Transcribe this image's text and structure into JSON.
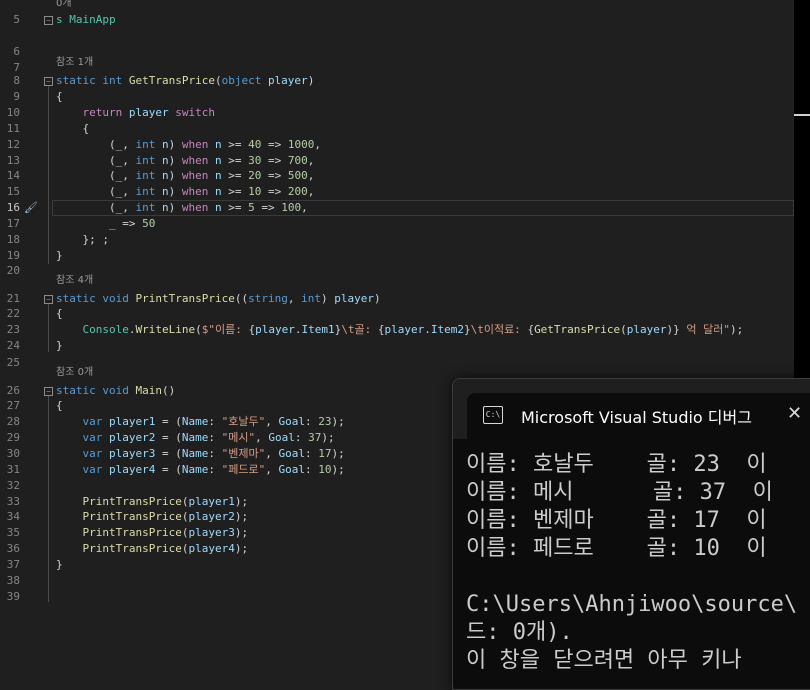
{
  "editor": {
    "lines": [
      {
        "num": "5",
        "code": [
          {
            "t": "s MainApp",
            "c": "ty"
          }
        ],
        "ref": "0개"
      },
      {
        "num": "6",
        "code": []
      },
      {
        "num": "7",
        "code": []
      },
      {
        "num": "8",
        "code": [
          {
            "t": "static ",
            "c": "kw"
          },
          {
            "t": "int ",
            "c": "kw"
          },
          {
            "t": "GetTransPrice",
            "c": "fn"
          },
          {
            "t": "("
          },
          {
            "t": "object ",
            "c": "kw"
          },
          {
            "t": "player",
            "c": "vr"
          },
          {
            "t": ")"
          }
        ],
        "ref": "참조 1개"
      },
      {
        "num": "9",
        "code": [
          {
            "t": "{"
          }
        ]
      },
      {
        "num": "10",
        "code": [
          {
            "t": "    "
          },
          {
            "t": "return ",
            "c": "ct"
          },
          {
            "t": "player ",
            "c": "vr"
          },
          {
            "t": "switch",
            "c": "ct"
          }
        ]
      },
      {
        "num": "11",
        "code": [
          {
            "t": "    {"
          }
        ]
      },
      {
        "num": "12",
        "code": [
          {
            "t": "        (_, "
          },
          {
            "t": "int ",
            "c": "kw"
          },
          {
            "t": "n",
            "c": "vr"
          },
          {
            "t": ") "
          },
          {
            "t": "when ",
            "c": "ct"
          },
          {
            "t": "n",
            "c": "vr"
          },
          {
            "t": " >= "
          },
          {
            "t": "40",
            "c": "nm"
          },
          {
            "t": " => "
          },
          {
            "t": "1000",
            "c": "nm"
          },
          {
            "t": ","
          }
        ]
      },
      {
        "num": "13",
        "code": [
          {
            "t": "        (_, "
          },
          {
            "t": "int ",
            "c": "kw"
          },
          {
            "t": "n",
            "c": "vr"
          },
          {
            "t": ") "
          },
          {
            "t": "when ",
            "c": "ct"
          },
          {
            "t": "n",
            "c": "vr"
          },
          {
            "t": " >= "
          },
          {
            "t": "30",
            "c": "nm"
          },
          {
            "t": " => "
          },
          {
            "t": "700",
            "c": "nm"
          },
          {
            "t": ","
          }
        ]
      },
      {
        "num": "14",
        "code": [
          {
            "t": "        (_, "
          },
          {
            "t": "int ",
            "c": "kw"
          },
          {
            "t": "n",
            "c": "vr"
          },
          {
            "t": ") "
          },
          {
            "t": "when ",
            "c": "ct"
          },
          {
            "t": "n",
            "c": "vr"
          },
          {
            "t": " >= "
          },
          {
            "t": "20",
            "c": "nm"
          },
          {
            "t": " => "
          },
          {
            "t": "500",
            "c": "nm"
          },
          {
            "t": ","
          }
        ]
      },
      {
        "num": "15",
        "code": [
          {
            "t": "        (_, "
          },
          {
            "t": "int ",
            "c": "kw"
          },
          {
            "t": "n",
            "c": "vr"
          },
          {
            "t": ") "
          },
          {
            "t": "when ",
            "c": "ct"
          },
          {
            "t": "n",
            "c": "vr"
          },
          {
            "t": " >= "
          },
          {
            "t": "10",
            "c": "nm"
          },
          {
            "t": " => "
          },
          {
            "t": "200",
            "c": "nm"
          },
          {
            "t": ","
          }
        ]
      },
      {
        "num": "16",
        "code": [
          {
            "t": "        (_, "
          },
          {
            "t": "int ",
            "c": "kw"
          },
          {
            "t": "n",
            "c": "vr"
          },
          {
            "t": ") "
          },
          {
            "t": "when ",
            "c": "ct"
          },
          {
            "t": "n",
            "c": "vr"
          },
          {
            "t": " >= "
          },
          {
            "t": "5",
            "c": "nm"
          },
          {
            "t": " => "
          },
          {
            "t": "100",
            "c": "nm"
          },
          {
            "t": ","
          }
        ],
        "current": true
      },
      {
        "num": "17",
        "code": [
          {
            "t": "        _ => "
          },
          {
            "t": "50",
            "c": "nm"
          }
        ]
      },
      {
        "num": "18",
        "code": [
          {
            "t": "    }; ;"
          }
        ]
      },
      {
        "num": "19",
        "code": [
          {
            "t": "}"
          }
        ]
      },
      {
        "num": "20",
        "code": []
      },
      {
        "num": "21",
        "code": [
          {
            "t": "static ",
            "c": "kw"
          },
          {
            "t": "void ",
            "c": "kw"
          },
          {
            "t": "PrintTransPrice",
            "c": "fn"
          },
          {
            "t": "(("
          },
          {
            "t": "string",
            "c": "kw"
          },
          {
            "t": ", "
          },
          {
            "t": "int",
            "c": "kw"
          },
          {
            "t": ") "
          },
          {
            "t": "player",
            "c": "vr"
          },
          {
            "t": ")"
          }
        ],
        "ref": "참조 4개"
      },
      {
        "num": "22",
        "code": [
          {
            "t": "{"
          }
        ]
      },
      {
        "num": "23",
        "code": [
          {
            "t": "    "
          },
          {
            "t": "Console",
            "c": "ty"
          },
          {
            "t": "."
          },
          {
            "t": "WriteLine",
            "c": "fn"
          },
          {
            "t": "("
          },
          {
            "t": "$\"이름: ",
            "c": "st"
          },
          {
            "t": "{"
          },
          {
            "t": "player",
            "c": "vr"
          },
          {
            "t": "."
          },
          {
            "t": "Item1",
            "c": "vr"
          },
          {
            "t": "}"
          },
          {
            "t": "\\t골: ",
            "c": "st"
          },
          {
            "t": "{"
          },
          {
            "t": "player",
            "c": "vr"
          },
          {
            "t": "."
          },
          {
            "t": "Item2",
            "c": "vr"
          },
          {
            "t": "}"
          },
          {
            "t": "\\t이적료: ",
            "c": "st"
          },
          {
            "t": "{"
          },
          {
            "t": "GetTransPrice",
            "c": "fn"
          },
          {
            "t": "("
          },
          {
            "t": "player",
            "c": "vr"
          },
          {
            "t": ")"
          },
          {
            "t": "}"
          },
          {
            "t": " 억 달러\"",
            "c": "st"
          },
          {
            "t": ");"
          }
        ]
      },
      {
        "num": "24",
        "code": [
          {
            "t": "}"
          }
        ]
      },
      {
        "num": "25",
        "code": []
      },
      {
        "num": "26",
        "code": [
          {
            "t": "static ",
            "c": "kw"
          },
          {
            "t": "void ",
            "c": "kw"
          },
          {
            "t": "Main",
            "c": "fn"
          },
          {
            "t": "()"
          }
        ],
        "ref": "참조 0개"
      },
      {
        "num": "27",
        "code": [
          {
            "t": "{"
          }
        ]
      },
      {
        "num": "28",
        "code": [
          {
            "t": "    "
          },
          {
            "t": "var ",
            "c": "kw"
          },
          {
            "t": "player1",
            "c": "vr"
          },
          {
            "t": " = ("
          },
          {
            "t": "Name",
            "c": "vr"
          },
          {
            "t": ": "
          },
          {
            "t": "\"호날두\"",
            "c": "st"
          },
          {
            "t": ", "
          },
          {
            "t": "Goal",
            "c": "vr"
          },
          {
            "t": ": "
          },
          {
            "t": "23",
            "c": "nm"
          },
          {
            "t": ");"
          }
        ]
      },
      {
        "num": "29",
        "code": [
          {
            "t": "    "
          },
          {
            "t": "var ",
            "c": "kw"
          },
          {
            "t": "player2",
            "c": "vr"
          },
          {
            "t": " = ("
          },
          {
            "t": "Name",
            "c": "vr"
          },
          {
            "t": ": "
          },
          {
            "t": "\"메시\"",
            "c": "st"
          },
          {
            "t": ", "
          },
          {
            "t": "Goal",
            "c": "vr"
          },
          {
            "t": ": "
          },
          {
            "t": "37",
            "c": "nm"
          },
          {
            "t": ");"
          }
        ]
      },
      {
        "num": "30",
        "code": [
          {
            "t": "    "
          },
          {
            "t": "var ",
            "c": "kw"
          },
          {
            "t": "player3",
            "c": "vr"
          },
          {
            "t": " = ("
          },
          {
            "t": "Name",
            "c": "vr"
          },
          {
            "t": ": "
          },
          {
            "t": "\"벤제마\"",
            "c": "st"
          },
          {
            "t": ", "
          },
          {
            "t": "Goal",
            "c": "vr"
          },
          {
            "t": ": "
          },
          {
            "t": "17",
            "c": "nm"
          },
          {
            "t": ");"
          }
        ]
      },
      {
        "num": "31",
        "code": [
          {
            "t": "    "
          },
          {
            "t": "var ",
            "c": "kw"
          },
          {
            "t": "player4",
            "c": "vr"
          },
          {
            "t": " = ("
          },
          {
            "t": "Name",
            "c": "vr"
          },
          {
            "t": ": "
          },
          {
            "t": "\"페드로\"",
            "c": "st"
          },
          {
            "t": ", "
          },
          {
            "t": "Goal",
            "c": "vr"
          },
          {
            "t": ": "
          },
          {
            "t": "10",
            "c": "nm"
          },
          {
            "t": ");"
          }
        ]
      },
      {
        "num": "32",
        "code": []
      },
      {
        "num": "33",
        "code": [
          {
            "t": "    "
          },
          {
            "t": "PrintTransPrice",
            "c": "fn"
          },
          {
            "t": "("
          },
          {
            "t": "player1",
            "c": "vr"
          },
          {
            "t": ");"
          }
        ]
      },
      {
        "num": "34",
        "code": [
          {
            "t": "    "
          },
          {
            "t": "PrintTransPrice",
            "c": "fn"
          },
          {
            "t": "("
          },
          {
            "t": "player2",
            "c": "vr"
          },
          {
            "t": ");"
          }
        ]
      },
      {
        "num": "35",
        "code": [
          {
            "t": "    "
          },
          {
            "t": "PrintTransPrice",
            "c": "fn"
          },
          {
            "t": "("
          },
          {
            "t": "player3",
            "c": "vr"
          },
          {
            "t": ");"
          }
        ]
      },
      {
        "num": "36",
        "code": [
          {
            "t": "    "
          },
          {
            "t": "PrintTransPrice",
            "c": "fn"
          },
          {
            "t": "("
          },
          {
            "t": "player4",
            "c": "vr"
          },
          {
            "t": ");"
          }
        ]
      },
      {
        "num": "37",
        "code": [
          {
            "t": "}"
          }
        ]
      },
      {
        "num": "38",
        "code": []
      },
      {
        "num": "39",
        "code": []
      }
    ]
  },
  "console": {
    "title": "Microsoft Visual Studio 디버그",
    "icon_label": "C:\\",
    "close_icon": "close-icon",
    "lines": [
      "이름: 호날두    골: 23  이",
      "이름: 메시      골: 37  이",
      "이름: 벤제마    골: 17  이",
      "이름: 페드로    골: 10  이",
      "",
      "C:\\Users\\Ahnjiwoo\\source\\",
      "드: 0개).",
      "이 창을 닫으려면 아무 키나"
    ]
  }
}
